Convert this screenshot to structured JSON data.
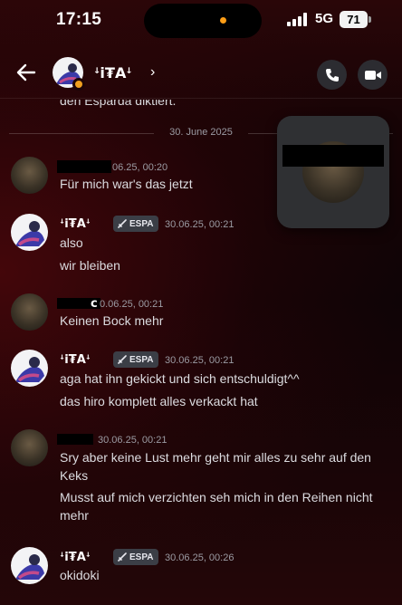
{
  "status_bar": {
    "time": "17:15",
    "network": "5G",
    "battery": "71"
  },
  "header": {
    "title": "ꜜⅰ₮Aꜜ",
    "chevron": "›"
  },
  "chat": {
    "cut_off_text": "den Esparda diktiert.",
    "date_divider": "30. June 2025",
    "messages": [
      {
        "author": "",
        "time": "06.25, 00:20",
        "lines": [
          "Für mich war's das jetzt"
        ]
      },
      {
        "author": "ꜜⅰ₮Aꜜ",
        "tag": "ESPA",
        "time": "30.06.25, 00:21",
        "lines": [
          "also",
          "wir bleiben"
        ]
      },
      {
        "author": "c",
        "time": "0.06.25, 00:21",
        "lines": [
          "Keinen Bock mehr"
        ]
      },
      {
        "author": "ꜜⅰ₮Aꜜ",
        "tag": "ESPA",
        "time": "30.06.25, 00:21",
        "lines": [
          "aga hat ihn gekickt und sich entschuldigt^^",
          "das hiro komplett alles verkackt hat"
        ]
      },
      {
        "author": "",
        "time": "30.06.25, 00:21",
        "lines": [
          "Sry aber keine Lust mehr geht mir alles zu sehr auf den Keks",
          "Musst auf mich verzichten seh mich in den Reihen nicht mehr"
        ]
      },
      {
        "author": "ꜜⅰ₮Aꜜ",
        "tag": "ESPA",
        "time": "30.06.25, 00:26",
        "lines": [
          "okidoki"
        ]
      }
    ]
  },
  "colors": {
    "accent": "#ff9e16",
    "tag_bg": "#3b3e46"
  }
}
